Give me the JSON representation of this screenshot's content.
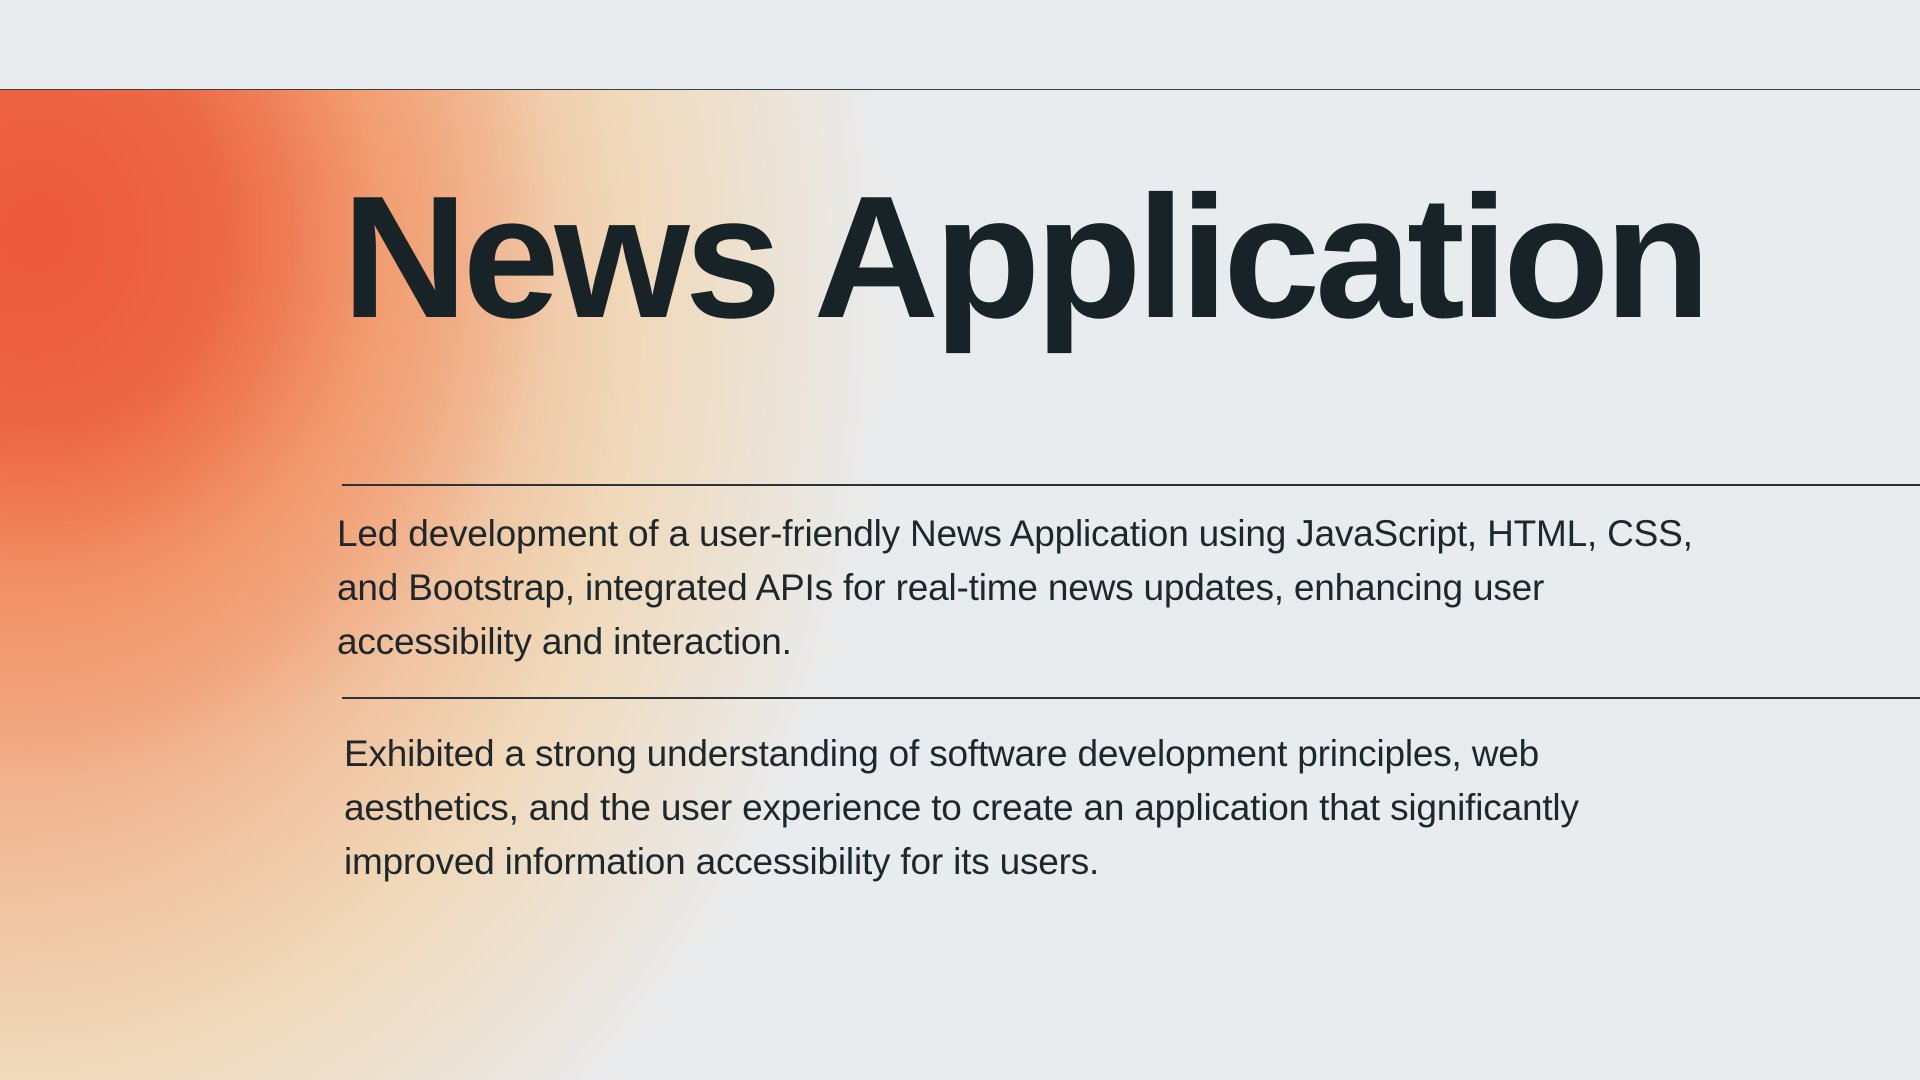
{
  "slide": {
    "title": "News Application",
    "paragraphs": [
      "Led development of a user-friendly News Application using JavaScript, HTML, CSS, and Bootstrap, integrated APIs for real-time news updates, enhancing user accessibility and interaction.",
      "Exhibited a strong understanding of software development principles, web aesthetics, and the user experience to create an application that significantly improved information accessibility for its users."
    ]
  },
  "colors": {
    "background": "#e9ecef",
    "text": "#172326",
    "gradient_red": "#ec563a",
    "gradient_yellow": "#f6c88c"
  }
}
